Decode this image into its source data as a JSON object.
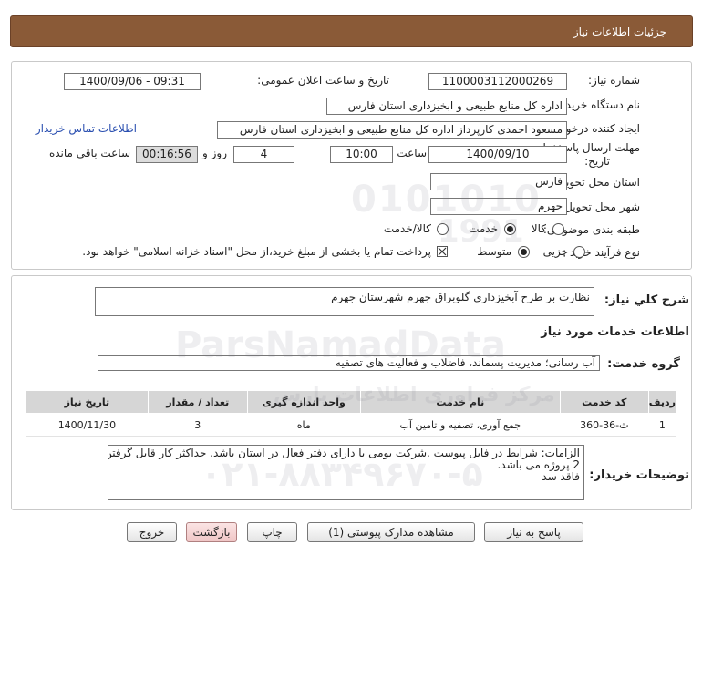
{
  "page": {
    "title": "جزئیات اطلاعات نیاز"
  },
  "need_info": {
    "need_number_label": "شماره نیاز:",
    "need_number": "1100003112000269",
    "announce_label": "تاریخ و ساعت اعلان عمومی:",
    "announce_value": "1400/09/06 - 09:31",
    "buyer_org_label": "نام دستگاه خریدار:",
    "buyer_org": "اداره کل منابع طبیعی و ابخیزداری استان فارس",
    "requester_label": "ایجاد کننده درخواست:",
    "requester": "مسعود احمدی کارپرداز اداره کل منابع طبیعی و ابخیزداری استان فارس",
    "contact_link": "اطلاعات تماس خریدار",
    "deadline_label_1": "مهلت ارسال پاسخ: تا",
    "deadline_label_2": "تاریخ:",
    "deadline_date": "1400/09/10",
    "time_label": "ساعت",
    "deadline_time": "10:00",
    "days": "4",
    "days_label": "روز و",
    "remaining": "00:16:56",
    "remaining_label": "ساعت باقی مانده",
    "province_label": "استان محل تحویل:",
    "province": "فارس",
    "city_label": "شهر محل تحویل:",
    "city": "جهرم",
    "category_label": "طبقه بندی موضوعی:",
    "category_options": [
      "کالا",
      "خدمت",
      "کالا/خدمت"
    ],
    "category_selected": 1,
    "process_label": "نوع فرآیند خرید :",
    "process_options": [
      "جزیی",
      "متوسط"
    ],
    "process_selected": 1,
    "payment_note": "پرداخت تمام یا بخشی از مبلغ خرید،از محل \"اسناد خزانه اسلامی\" خواهد بود."
  },
  "description": {
    "label": "شرح کلي نياز:",
    "value": "نظارت بر طرح آبخیزداری گلوبراق جهرم شهرستان جهرم",
    "services_heading": "اطلاعات خدمات مورد نیاز",
    "group_label": "گروه خدمت:",
    "group_value": "آب رسانی؛ مدیریت پسماند، فاضلاب و فعالیت های تصفیه"
  },
  "table": {
    "headers": [
      "ردیف",
      "کد خدمت",
      "نام خدمت",
      "واحد اندازه گیری",
      "تعداد / مقدار",
      "تاریخ نیاز"
    ],
    "rows": [
      [
        "1",
        "ث-36-360",
        "جمع آوری، تصفیه و تامین آب",
        "ماه",
        "3",
        "1400/11/30"
      ]
    ]
  },
  "buyer_notes": {
    "label": "توضیحات خریدار:",
    "line1": "الزامات: شرایط در فایل پیوست .شرکت بومی یا دارای دفتر فعال در استان باشد. حداکثر کار قابل گرفتن",
    "line2": "2 پروژه می باشد.",
    "line3": "فاقد سد"
  },
  "buttons": {
    "reply": "پاسخ به نیاز",
    "attachments": "مشاهده مدارک پیوستی (1)",
    "print": "چاپ",
    "back": "بازگشت",
    "exit": "خروج"
  },
  "watermark": {
    "number": "0101010",
    "number2": "1991",
    "brand": "ParsNamadData",
    "tagline": "مرکز فراوری اطلاعات پارس",
    "phone": "۰۲۱-۸۸۳۴۹۶۷۰-۵"
  },
  "colors": {
    "title_bar": "#8a5a37",
    "remaining_bg": "#dcdcdc",
    "link": "#2a4fb0",
    "pink_button": "#f0c6c6"
  }
}
